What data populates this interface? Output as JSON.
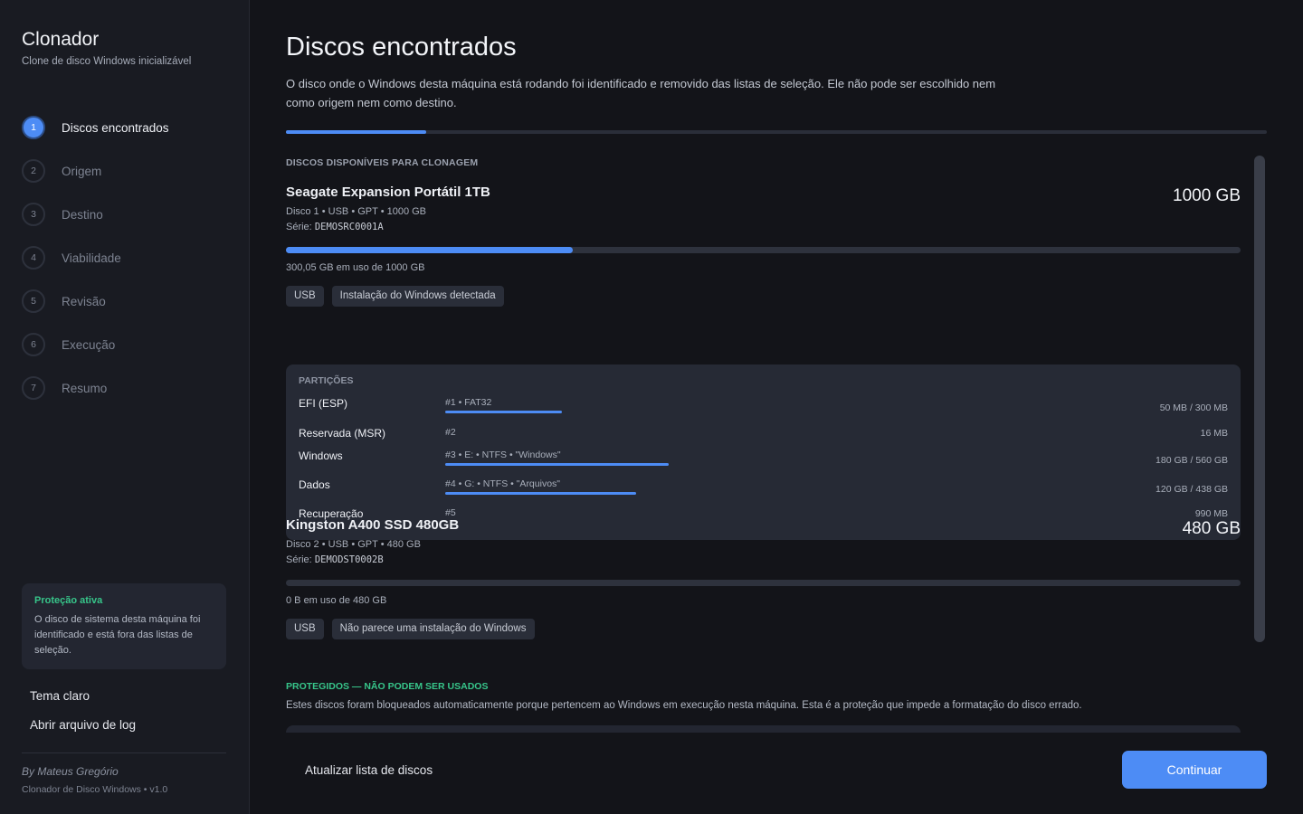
{
  "app": {
    "title": "Clonador",
    "subtitle": "Clone de disco Windows inicializável"
  },
  "steps": [
    {
      "num": "1",
      "label": "Discos encontrados",
      "active": true
    },
    {
      "num": "2",
      "label": "Origem",
      "active": false
    },
    {
      "num": "3",
      "label": "Destino",
      "active": false
    },
    {
      "num": "4",
      "label": "Viabilidade",
      "active": false
    },
    {
      "num": "5",
      "label": "Revisão",
      "active": false
    },
    {
      "num": "6",
      "label": "Execução",
      "active": false
    },
    {
      "num": "7",
      "label": "Resumo",
      "active": false
    }
  ],
  "protection": {
    "title": "Proteção ativa",
    "text": "O disco de sistema desta máquina foi identificado e está fora das listas de seleção."
  },
  "sidebar_links": {
    "theme": "Tema claro",
    "log": "Abrir arquivo de log"
  },
  "footer": {
    "author": "By Mateus Gregório",
    "version": "Clonador de Disco Windows • v1.0"
  },
  "page": {
    "title": "Discos encontrados",
    "description": "O disco onde o Windows desta máquina está rodando foi identificado e removido das listas de seleção. Ele não pode ser escolhido nem como origem nem como destino.",
    "progress": 0.143
  },
  "available": {
    "section_title": "DISCOS DISPONÍVEIS PARA CLONAGEM",
    "disks": [
      {
        "name": "Seagate Expansion Portátil 1TB",
        "size": "1000 GB",
        "meta": "Disco 1  •  USB  •  GPT  •  1000 GB",
        "serial_label": "Série:",
        "serial": "DEMOSRC0001A",
        "usage_fraction": 0.3,
        "usage_text": "300,05 GB em uso de 1000 GB",
        "tags": [
          "USB",
          "Instalação do Windows detectada"
        ],
        "partitions_title": "PARTIÇÕES",
        "partitions": [
          {
            "name": "EFI (ESP)",
            "info": "#1  •  FAT32",
            "size": "50 MB / 300 MB",
            "fraction": 0.167
          },
          {
            "name": "Reservada (MSR)",
            "info": "#2",
            "size": "16 MB",
            "fraction": null
          },
          {
            "name": "Windows",
            "info": "#3  •  E:  •  NTFS  •  \"Windows\"",
            "size": "180 GB / 560 GB",
            "fraction": 0.321
          },
          {
            "name": "Dados",
            "info": "#4  •  G:  •  NTFS  •  \"Arquivos\"",
            "size": "120 GB / 438 GB",
            "fraction": 0.274
          },
          {
            "name": "Recuperação",
            "info": "#5",
            "size": "990 MB",
            "fraction": null
          }
        ]
      },
      {
        "name": "Kingston A400 SSD 480GB",
        "size": "480 GB",
        "meta": "Disco 2  •  USB  •  GPT  •  480 GB",
        "serial_label": "Série:",
        "serial": "DEMODST0002B",
        "usage_fraction": 0,
        "usage_text": "0 B em uso de 480 GB",
        "tags": [
          "USB",
          "Não parece uma instalação do Windows"
        ]
      }
    ]
  },
  "protected": {
    "title": "PROTEGIDOS — NÃO PODEM SER USADOS",
    "description": "Estes discos foram bloqueados automaticamente porque pertencem ao Windows em execução nesta máquina. Esta é a proteção que impede a formatação do disco errado."
  },
  "actions": {
    "refresh": "Atualizar lista de discos",
    "continue": "Continuar"
  },
  "colors": {
    "accent": "#4d8cf5",
    "success": "#37c58a",
    "background": "#131419",
    "sidebar": "#191b22"
  }
}
